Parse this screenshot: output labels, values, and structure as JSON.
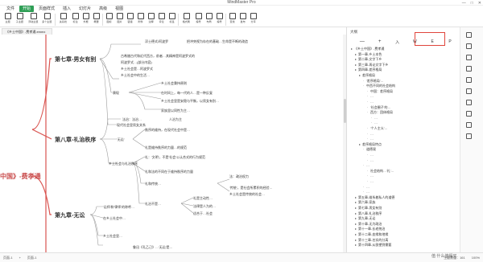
{
  "window": {
    "title": "MindMaster Pro",
    "controls": [
      "—",
      "□",
      "✕"
    ]
  },
  "menu": [
    {
      "label": "文件",
      "active": false
    },
    {
      "label": "开始",
      "active": true
    },
    {
      "label": "页面样式",
      "active": false
    },
    {
      "label": "插入",
      "active": false
    },
    {
      "label": "幻灯片",
      "active": false
    },
    {
      "label": "高级",
      "active": false
    },
    {
      "label": "视图",
      "active": false
    }
  ],
  "ribbon": [
    {
      "label": "主题",
      "icon": "topic-icon"
    },
    {
      "label": "子主题",
      "icon": "subtopic-icon"
    },
    {
      "label": "浮动主题",
      "icon": "floating-topic-icon"
    },
    {
      "label": "多个主题",
      "icon": "multi-topic-icon"
    },
    {
      "label": "关系线",
      "icon": "relationship-icon"
    },
    {
      "label": "标注",
      "icon": "callout-icon"
    },
    {
      "label": "外框",
      "icon": "boundary-icon"
    },
    {
      "label": "概要",
      "icon": "summary-icon"
    },
    {
      "label": "图标",
      "icon": "mark-icon"
    },
    {
      "label": "图片",
      "icon": "image-icon"
    },
    {
      "label": "链接",
      "icon": "link-icon"
    },
    {
      "label": "附件",
      "icon": "attachment-icon"
    },
    {
      "label": "注释",
      "icon": "note-icon"
    },
    {
      "label": "评论",
      "icon": "comment-icon"
    },
    {
      "label": "标签",
      "icon": "tag-icon"
    },
    {
      "label": "格式刷",
      "icon": "format-painter-icon"
    },
    {
      "label": "编号",
      "icon": "numbering-icon"
    },
    {
      "label": "布局",
      "icon": "layout-icon"
    },
    {
      "label": "编号",
      "icon": "numbering-icon"
    },
    {
      "label": "查找",
      "icon": "search-icon"
    },
    {
      "label": "发布",
      "icon": "publish-icon"
    },
    {
      "label": "分享",
      "icon": "share-icon"
    }
  ],
  "doc_tab": "《乡土中国》-费孝通.emmx",
  "root_label": "中国》-费孝通",
  "chapters": [
    {
      "title": "第七章-男女有别"
    },
    {
      "title": "第八章-礼治秩序"
    },
    {
      "title": "第九章-无讼"
    }
  ],
  "nodes": {
    "c7": [
      "浮士德式/阿波罗",
      "把冲突视为存在的基础…生命是不断的改造",
      "古希腊古代和近代西方，前者…其精神是阿波罗式的",
      "阿波罗式…(部分内容)",
      "乡土社会是…阿波罗式",
      "乡土社会中的生活…",
      "表现",
      "乡土社会秉持原则",
      "在时间上，每一代的人…是一种反复",
      "乡土社会里是安稳与平衡，以男女有别…",
      "家族里以同性为主…",
      "现代社会里男女关系"
    ],
    "c8": [
      "法治：法治…",
      "人治为主",
      "礼治",
      "'无讼'",
      "秩序的维持，在现代社会中是…",
      "礼是维持秩序的力量…的规范",
      "礼：'文明'，不是'社会'公认合式的行为规范",
      "乡土社会与礼治秩序",
      "礼和法的不同在于维持秩序的力量",
      "法：政治权力",
      "'传统'，是社会所累积的经验…",
      "乡土社会是传统的社会…",
      "礼和传统…",
      "礼是主动性…",
      "法律是人为的…",
      "礼治不是…",
      "适合于…社会"
    ],
    "c9": [
      "'讼师'和'律师'的称呼…",
      "在乡土社会中…",
      "乡土社会里…",
      "鲁迅《孔乙己》…'无讼'是…"
    ]
  },
  "outline": {
    "title": "大纲",
    "tools": [
      "—",
      "+",
      "入",
      "W",
      "E",
      "P"
    ],
    "highlighted": [
      "入",
      "W"
    ],
    "rows": [
      {
        "level": 0,
        "text": "《乡土中国》-费孝通"
      },
      {
        "level": 1,
        "text": "第一章-乡土本色"
      },
      {
        "level": 1,
        "text": "第二章-文字下乡"
      },
      {
        "level": 1,
        "text": "第三章-再论文字下乡"
      },
      {
        "level": 1,
        "text": "第四章-差序格局"
      },
      {
        "level": 2,
        "text": "差序格局"
      },
      {
        "level": 3,
        "text": "'差序格局'…"
      },
      {
        "level": 3,
        "text": "中西不同的社会结构"
      },
      {
        "level": 4,
        "text": "中国：差序格局"
      },
      {
        "level": 4,
        "text": "…"
      },
      {
        "level": 4,
        "text": "…"
      },
      {
        "level": 4,
        "text": "'社会圈子'的…"
      },
      {
        "level": 4,
        "text": "西方：团体格局"
      },
      {
        "level": 5,
        "text": "…"
      },
      {
        "level": 5,
        "text": "…"
      },
      {
        "level": 4,
        "text": "'个人主义'…"
      },
      {
        "level": 4,
        "text": "…"
      },
      {
        "level": 4,
        "text": "…"
      },
      {
        "level": 2,
        "text": "差序格局特点"
      },
      {
        "level": 3,
        "text": "道德观"
      },
      {
        "level": 4,
        "text": "…"
      },
      {
        "level": 4,
        "text": "…"
      },
      {
        "level": 3,
        "text": "…"
      },
      {
        "level": 4,
        "text": "社会结构…'礼'…"
      },
      {
        "level": 4,
        "text": "…"
      },
      {
        "level": 4,
        "text": "…"
      },
      {
        "level": 3,
        "text": "…"
      },
      {
        "level": 3,
        "text": "…"
      },
      {
        "level": 1,
        "text": "第五章-维系着私人的道德"
      },
      {
        "level": 1,
        "text": "第六章-家族"
      },
      {
        "level": 1,
        "text": "第七章-男女有别"
      },
      {
        "level": 1,
        "text": "第八章-礼治秩序"
      },
      {
        "level": 1,
        "text": "第九章-无讼"
      },
      {
        "level": 1,
        "text": "第十章-无为政治"
      },
      {
        "level": 1,
        "text": "第十一章-长老统治"
      },
      {
        "level": 1,
        "text": "第十二章-血缘和地缘"
      },
      {
        "level": 1,
        "text": "第十三章-名实的分离"
      },
      {
        "level": 1,
        "text": "第十四章-从欲望到需要"
      }
    ]
  },
  "status": {
    "page": "页面-1",
    "add": "+",
    "current": "页面-1",
    "topic_count": "主题数量：161",
    "zoom": "100%"
  },
  "watermark": "值 什么值得买",
  "colors": {
    "accent": "#2e9e55",
    "root": "#c94d4d",
    "branch_red": "#d9534f",
    "line": "#888888",
    "highlight_box": "#e0453c"
  }
}
